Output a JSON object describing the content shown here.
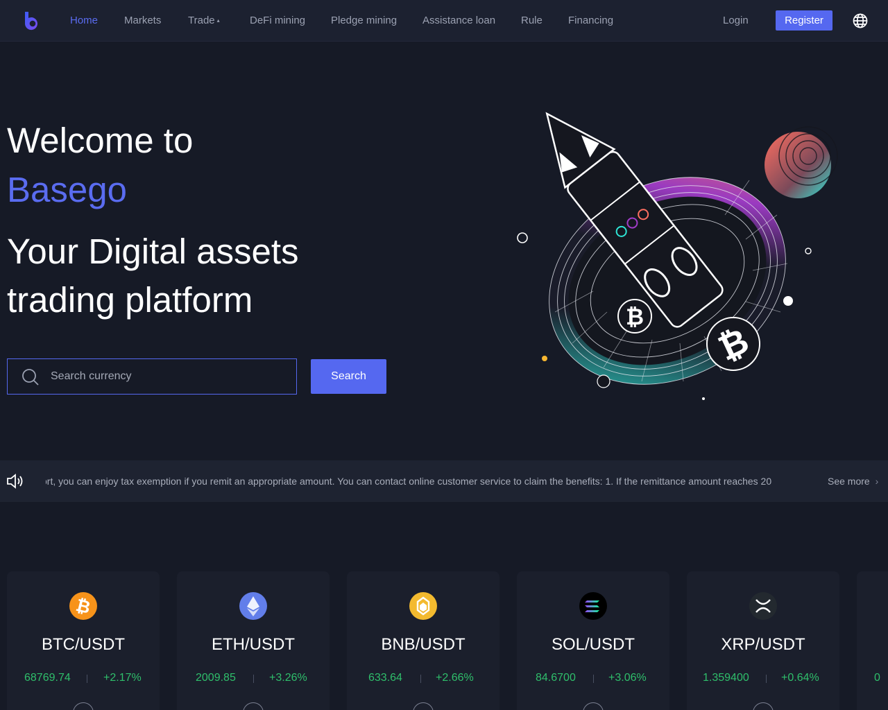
{
  "nav": {
    "items": [
      {
        "label": "Home",
        "active": true
      },
      {
        "label": "Markets"
      },
      {
        "label": "Trade",
        "has_caret": true
      },
      {
        "label": "DeFi mining"
      },
      {
        "label": "Pledge mining"
      },
      {
        "label": "Assistance loan"
      },
      {
        "label": "Rule"
      },
      {
        "label": "Financing"
      }
    ],
    "login_label": "Login",
    "register_label": "Register",
    "caret_glyph": "▴",
    "logo_icon": "logo-b",
    "language_icon": "globe-icon"
  },
  "hero": {
    "welcome": "Welcome to",
    "brand": "Basego",
    "tagline_line1": "Your Digital assets",
    "tagline_line2": "trading platform",
    "search_placeholder": "Search currency",
    "search_value": "",
    "search_button": "Search"
  },
  "notice": {
    "text": "ort, you can enjoy tax exemption if you remit an appropriate amount. You can contact online customer service to claim the benefits: 1. If the remittance amount reaches 20",
    "see_more": "See more",
    "see_more_chevron": "›"
  },
  "markets": [
    {
      "pair": "BTC/USDT",
      "price": "68769.74",
      "change": "+2.17%",
      "icon": "btc-icon",
      "color": "#f7931a"
    },
    {
      "pair": "ETH/USDT",
      "price": "2009.85",
      "change": "+3.26%",
      "icon": "eth-icon",
      "color": "#627eea"
    },
    {
      "pair": "BNB/USDT",
      "price": "633.64",
      "change": "+2.66%",
      "icon": "bnb-icon",
      "color": "#f3ba2f"
    },
    {
      "pair": "SOL/USDT",
      "price": "84.6700",
      "change": "+3.06%",
      "icon": "sol-icon",
      "color": "#14f195"
    },
    {
      "pair": "XRP/USDT",
      "price": "1.359400",
      "change": "+0.64%",
      "icon": "xrp-icon",
      "color": "#23292f"
    },
    {
      "pair": "",
      "price": "0",
      "change": "",
      "icon": "",
      "color": "#1b1f2c"
    }
  ],
  "colors": {
    "accent": "#5568f0",
    "positive": "#2fbf6b",
    "background": "#161a26",
    "nav_bg": "#1c2130"
  }
}
